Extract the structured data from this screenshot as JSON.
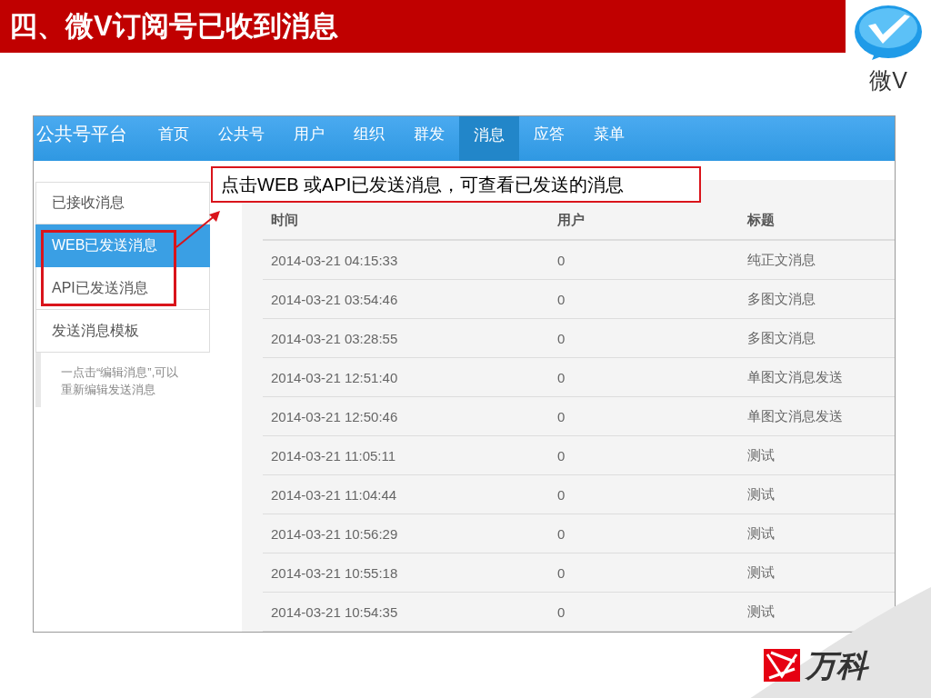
{
  "slide": {
    "title": "四、微V订阅号已收到消息",
    "logo_text": "微V",
    "footer_logo_text": "万科"
  },
  "app": {
    "brand": "公共号平台",
    "nav": [
      {
        "label": "首页",
        "selected": false
      },
      {
        "label": "公共号",
        "selected": false
      },
      {
        "label": "用户",
        "selected": false
      },
      {
        "label": "组织",
        "selected": false
      },
      {
        "label": "群发",
        "selected": false
      },
      {
        "label": "消息",
        "selected": true
      },
      {
        "label": "应答",
        "selected": false
      },
      {
        "label": "菜单",
        "selected": false
      }
    ],
    "sidebar": {
      "items": [
        {
          "label": "已接收消息",
          "selected": false
        },
        {
          "label": "WEB已发送消息",
          "selected": true
        },
        {
          "label": "API已发送消息",
          "selected": false
        },
        {
          "label": "发送消息模板",
          "selected": false
        }
      ],
      "note": "一点击“编辑消息”,可以重新编辑发送消息"
    },
    "table": {
      "columns": [
        "时间",
        "用户",
        "标题"
      ],
      "rows": [
        [
          "2014-03-21 04:15:33",
          "0",
          "纯正文消息"
        ],
        [
          "2014-03-21 03:54:46",
          "0",
          "多图文消息"
        ],
        [
          "2014-03-21 03:28:55",
          "0",
          "多图文消息"
        ],
        [
          "2014-03-21 12:51:40",
          "0",
          "单图文消息发送"
        ],
        [
          "2014-03-21 12:50:46",
          "0",
          "单图文消息发送"
        ],
        [
          "2014-03-21 11:05:11",
          "0",
          "测试"
        ],
        [
          "2014-03-21 11:04:44",
          "0",
          "测试"
        ],
        [
          "2014-03-21 10:56:29",
          "0",
          "测试"
        ],
        [
          "2014-03-21 10:55:18",
          "0",
          "测试"
        ],
        [
          "2014-03-21 10:54:35",
          "0",
          "测试"
        ]
      ]
    }
  },
  "callout": {
    "text": "点击WEB 或API已发送消息，可查看已发送的消息"
  }
}
